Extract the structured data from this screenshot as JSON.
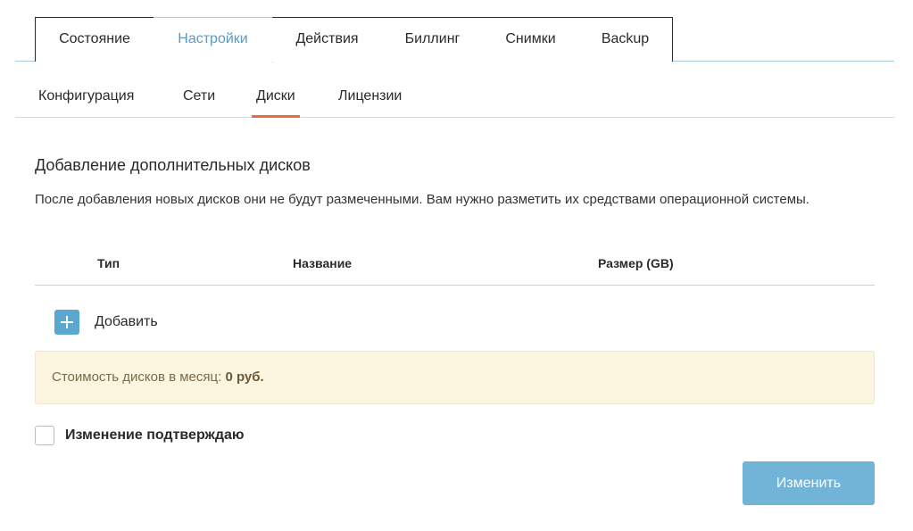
{
  "top_tabs": [
    {
      "label": "Состояние",
      "active": false
    },
    {
      "label": "Настройки",
      "active": true
    },
    {
      "label": "Действия",
      "active": false
    },
    {
      "label": "Биллинг",
      "active": false
    },
    {
      "label": "Снимки",
      "active": false
    },
    {
      "label": "Backup",
      "active": false
    }
  ],
  "sub_tabs": [
    {
      "label": "Конфигурация",
      "active": false
    },
    {
      "label": "Сети",
      "active": false
    },
    {
      "label": "Диски",
      "active": true
    },
    {
      "label": "Лицензии",
      "active": false
    }
  ],
  "section": {
    "title": "Добавление дополнительных дисков",
    "description": "После добавления новых дисков они не будут размеченными. Вам нужно разметить их средствами операционной системы."
  },
  "table": {
    "columns": [
      "Тип",
      "Название",
      "Размер (GB)"
    ]
  },
  "add": {
    "label": "Добавить",
    "icon": "plus-icon"
  },
  "cost": {
    "label": "Стоимость дисков в месяц:",
    "value": "0 руб."
  },
  "confirm": {
    "label": "Изменение подтверждаю",
    "checked": false
  },
  "submit": {
    "label": "Изменить"
  },
  "colors": {
    "accent": "#5aa7cf",
    "active_tab_text": "#5a9ac2",
    "sub_tab_underline": "#e86b3f",
    "cost_panel_bg": "#fcf5e0",
    "submit_bg": "#72b3d8"
  }
}
